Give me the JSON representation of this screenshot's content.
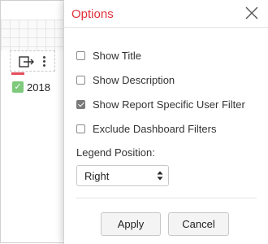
{
  "background_widget": {
    "legend": {
      "label": "2018",
      "checked": true,
      "color": "#7fc97c"
    },
    "toolbar": {
      "export_icon": "export-icon",
      "more_icon": "more-vertical-icon"
    },
    "series_color": "#e34d5a"
  },
  "options_panel": {
    "title": "Options",
    "title_color": "#e0313b",
    "close_icon": "close-icon",
    "checkboxes": [
      {
        "label": "Show Title",
        "checked": false
      },
      {
        "label": "Show Description",
        "checked": false
      },
      {
        "label": "Show Report Specific User Filter",
        "checked": true
      },
      {
        "label": "Exclude Dashboard Filters",
        "checked": false
      }
    ],
    "legend_position": {
      "label": "Legend Position:",
      "selected": "Right"
    },
    "buttons": {
      "apply": "Apply",
      "cancel": "Cancel"
    }
  }
}
